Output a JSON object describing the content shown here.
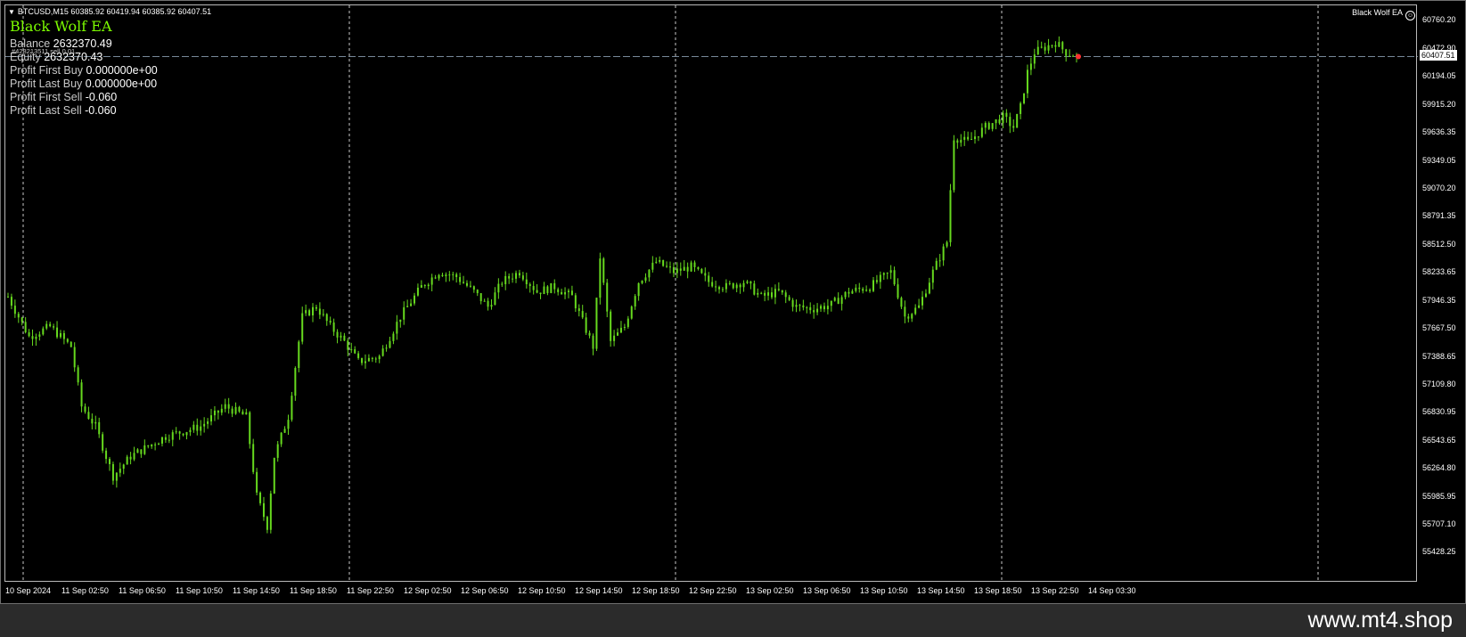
{
  "window": {
    "symbol_info": "BTCUSD,M15  60385.92 60419.94 60385.92 60407.51",
    "ea_title": "Black Wolf EA",
    "ea_corner_label": "Black Wolf EA",
    "trade_label": "#428213511 sell 0.01",
    "info": [
      {
        "label": "Balance",
        "value": "2632370.49"
      },
      {
        "label": "Equity",
        "value": "2632370.43"
      },
      {
        "label": "Profit First Buy",
        "value": "0.000000e+00"
      },
      {
        "label": "Profit Last Buy",
        "value": "0.000000e+00"
      },
      {
        "label": "Profit First Sell",
        "value": "-0.060"
      },
      {
        "label": "Profit Last Sell",
        "value": "-0.060"
      }
    ],
    "current_price": "60407.51",
    "watermark": "www.mt4.shop"
  },
  "colors": {
    "candle": "#66d91e",
    "grid": "#c8c8c8",
    "background": "#000000",
    "ask_line": "#778899"
  },
  "icons": {
    "menu": "triangle-down-icon",
    "ea": "smiley-icon"
  },
  "chart_data": {
    "type": "candlestick",
    "symbol": "BTCUSD",
    "timeframe": "M15",
    "ylim": [
      55428.25,
      60760.2
    ],
    "price_ticks": [
      "60760.20",
      "60472.90",
      "60194.05",
      "59915.20",
      "59636.35",
      "59349.05",
      "59070.20",
      "58791.35",
      "58512.50",
      "58233.65",
      "57946.35",
      "57667.50",
      "57388.65",
      "57109.80",
      "56830.95",
      "56543.65",
      "56264.80",
      "55985.95",
      "55707.10",
      "55428.25"
    ],
    "time_ticks": [
      "10 Sep 2024",
      "11 Sep 02:50",
      "11 Sep 06:50",
      "11 Sep 10:50",
      "11 Sep 14:50",
      "11 Sep 18:50",
      "11 Sep 22:50",
      "12 Sep 02:50",
      "12 Sep 06:50",
      "12 Sep 10:50",
      "12 Sep 14:50",
      "12 Sep 18:50",
      "12 Sep 22:50",
      "13 Sep 02:50",
      "13 Sep 06:50",
      "13 Sep 10:50",
      "13 Sep 14:50",
      "13 Sep 18:50",
      "13 Sep 22:50",
      "14 Sep 03:30"
    ],
    "last": {
      "open": 60385.92,
      "high": 60419.94,
      "low": 60385.92,
      "close": 60407.51
    },
    "close_path": [
      [
        0,
        58000
      ],
      [
        3,
        57800
      ],
      [
        6,
        57600
      ],
      [
        12,
        57700
      ],
      [
        18,
        57500
      ],
      [
        21,
        56900
      ],
      [
        25,
        56700
      ],
      [
        30,
        56200
      ],
      [
        35,
        56400
      ],
      [
        45,
        56600
      ],
      [
        55,
        56700
      ],
      [
        62,
        56900
      ],
      [
        68,
        56800
      ],
      [
        71,
        56000
      ],
      [
        74,
        55700
      ],
      [
        76,
        56400
      ],
      [
        80,
        56800
      ],
      [
        84,
        57800
      ],
      [
        88,
        57900
      ],
      [
        92,
        57700
      ],
      [
        96,
        57550
      ],
      [
        100,
        57350
      ],
      [
        106,
        57400
      ],
      [
        112,
        57800
      ],
      [
        118,
        58100
      ],
      [
        123,
        58250
      ],
      [
        128,
        58200
      ],
      [
        133,
        58050
      ],
      [
        137,
        57900
      ],
      [
        141,
        58150
      ],
      [
        146,
        58250
      ],
      [
        151,
        58050
      ],
      [
        156,
        58100
      ],
      [
        161,
        58000
      ],
      [
        164,
        57750
      ],
      [
        167,
        57500
      ],
      [
        169,
        58400
      ],
      [
        172,
        57550
      ],
      [
        176,
        57700
      ],
      [
        180,
        58150
      ],
      [
        185,
        58350
      ],
      [
        190,
        58250
      ],
      [
        195,
        58300
      ],
      [
        200,
        58150
      ],
      [
        205,
        58100
      ],
      [
        210,
        58150
      ],
      [
        215,
        58000
      ],
      [
        220,
        58050
      ],
      [
        225,
        57900
      ],
      [
        230,
        57880
      ],
      [
        235,
        57920
      ],
      [
        240,
        58050
      ],
      [
        246,
        58100
      ],
      [
        252,
        58250
      ],
      [
        256,
        57800
      ],
      [
        260,
        57900
      ],
      [
        264,
        58250
      ],
      [
        268,
        58550
      ],
      [
        270,
        59600
      ],
      [
        274,
        59550
      ],
      [
        279,
        59700
      ],
      [
        284,
        59800
      ],
      [
        287,
        59700
      ],
      [
        289,
        59900
      ],
      [
        291,
        60250
      ],
      [
        293,
        60450
      ],
      [
        296,
        60500
      ],
      [
        299,
        60550
      ],
      [
        302,
        60450
      ],
      [
        305,
        60410
      ]
    ],
    "ask_line": 60407.51
  }
}
